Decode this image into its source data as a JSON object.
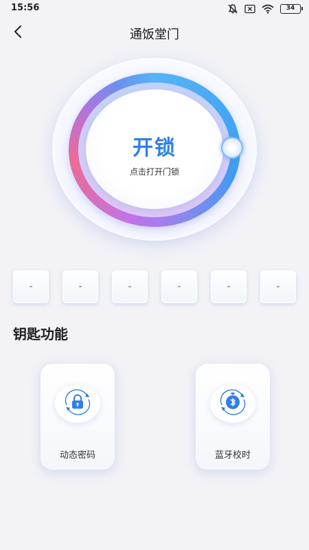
{
  "status_bar": {
    "time": "15:56",
    "battery": "34",
    "icons": [
      "mute-icon",
      "no-sim-icon",
      "wifi-icon",
      "battery-icon"
    ]
  },
  "nav": {
    "title": "通饭堂门",
    "back_icon": "chevron-left-icon"
  },
  "unlock": {
    "label": "开锁",
    "hint": "点击打开门锁",
    "accent_color": "#2f7fe6"
  },
  "digits": [
    "-",
    "-",
    "-",
    "-",
    "-",
    "-"
  ],
  "key_functions": {
    "title": "钥匙功能",
    "items": [
      {
        "label": "动态密码",
        "icon": "lock-refresh-icon"
      },
      {
        "label": "蓝牙校时",
        "icon": "bluetooth-clock-icon"
      }
    ]
  }
}
